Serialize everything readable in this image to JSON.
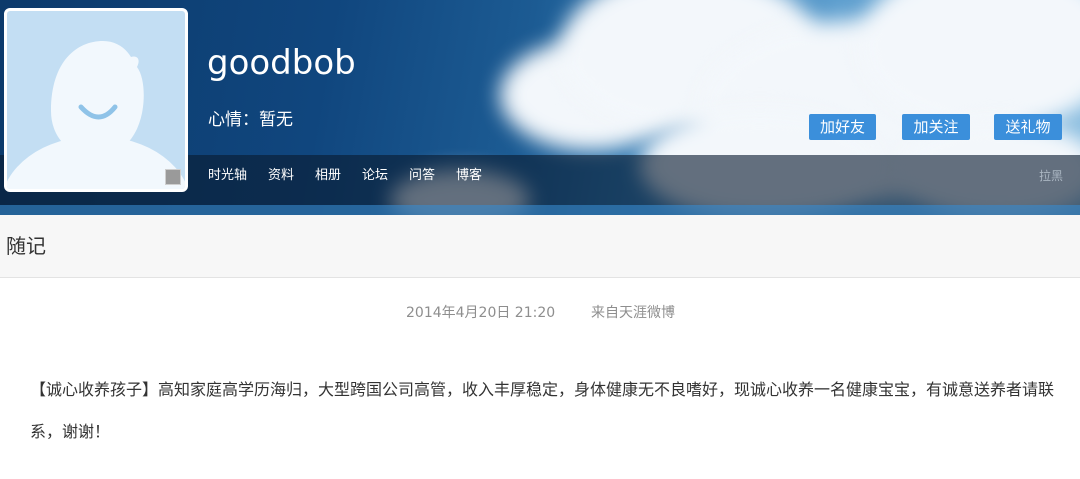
{
  "profile": {
    "username": "goodbob",
    "mood": "心情：暂无",
    "avatar_icon": "default-avatar-icon"
  },
  "actions": {
    "add_friend": "加好友",
    "follow": "加关注",
    "send_gift": "送礼物"
  },
  "nav": {
    "items": [
      "时光轴",
      "资料",
      "相册",
      "论坛",
      "问答",
      "博客"
    ],
    "block": "拉黑"
  },
  "section": {
    "title": "随记"
  },
  "post": {
    "timestamp": "2014年4月20日 21:20",
    "source": "来自天涯微博",
    "content": "【诚心收养孩子】高知家庭高学历海归，大型跨国公司高管，收入丰厚稳定，身体健康无不良嗜好，现诚心收养一名健康宝宝，有诚意送养者请联系，谢谢！"
  },
  "colors": {
    "button_blue": "#3b8fdb",
    "banner_dark": "#10467e",
    "avatar_bg": "#c3def3"
  }
}
